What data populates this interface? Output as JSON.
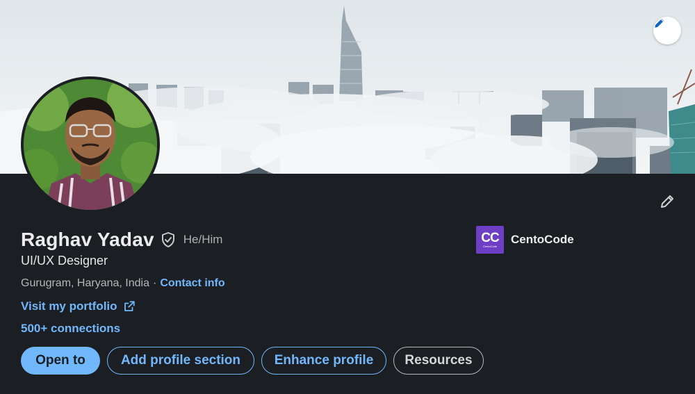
{
  "profile": {
    "name": "Raghav Yadav",
    "pronouns": "He/Him",
    "headline": "UI/UX Designer",
    "location": "Gurugram, Haryana, India",
    "separator": "·",
    "contact_label": "Contact info",
    "portfolio_label": "Visit my portfolio",
    "connections": "500+ connections"
  },
  "company": {
    "logo_text": "CC",
    "logo_subtext": "CentoCode",
    "name": "CentoCode"
  },
  "actions": {
    "open_to": "Open to",
    "add_section": "Add profile section",
    "enhance": "Enhance profile",
    "resources": "Resources"
  },
  "colors": {
    "accent": "#71b7fb",
    "background": "#1b1f23",
    "logo": "#6e3fc4"
  },
  "icons": {
    "cover_edit": "pencil-icon",
    "intro_edit": "pencil-icon",
    "verify": "shield-check-icon",
    "external": "external-link-icon"
  }
}
